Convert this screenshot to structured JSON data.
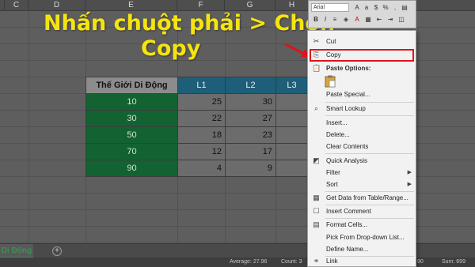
{
  "headline": {
    "line1": "Nhấn chuột phải > Chọn",
    "line2": "Copy"
  },
  "columns": [
    "C",
    "D",
    "E",
    "F",
    "G",
    "H"
  ],
  "table": {
    "header": [
      "Thế Giới Di Động",
      "L1",
      "L2",
      "L3"
    ],
    "rows": [
      [
        "10",
        "25",
        "30"
      ],
      [
        "30",
        "22",
        "27"
      ],
      [
        "50",
        "18",
        "23"
      ],
      [
        "70",
        "12",
        "17"
      ],
      [
        "90",
        "4",
        "9"
      ]
    ]
  },
  "mini_toolbar": {
    "font": "Arial",
    "bold": "B",
    "italic": "I"
  },
  "menu": {
    "cut": "Cut",
    "copy": "Copy",
    "paste_options": "Paste Options:",
    "paste_special": "Paste Special...",
    "smart_lookup": "Smart Lookup",
    "insert": "Insert...",
    "delete": "Delete...",
    "clear_contents": "Clear Contents",
    "quick_analysis": "Quick Analysis",
    "filter": "Filter",
    "sort": "Sort",
    "get_data": "Get Data from Table/Range...",
    "insert_comment": "Insert Comment",
    "format_cells": "Format Cells...",
    "pick_list": "Pick From Drop-down List...",
    "define_name": "Define Name...",
    "link": "Link"
  },
  "sheet_tab": "Di Động",
  "add_sheet": "+",
  "status": {
    "average": "Average: 27.96",
    "count": "Count: 3",
    "right1": "90",
    "right2": "Sum: 699"
  },
  "colors": {
    "highlight": "#f5e50f",
    "copy_box": "#e0121b",
    "green": "#136231",
    "blue_header": "#1f5e78"
  },
  "icons": [
    "scissors-icon",
    "copy-icon",
    "paste-icon",
    "clipboard-icon",
    "search-icon",
    "quick-analysis-icon",
    "table-icon",
    "comment-icon",
    "format-cells-icon",
    "link-icon",
    "arrow-icon"
  ]
}
